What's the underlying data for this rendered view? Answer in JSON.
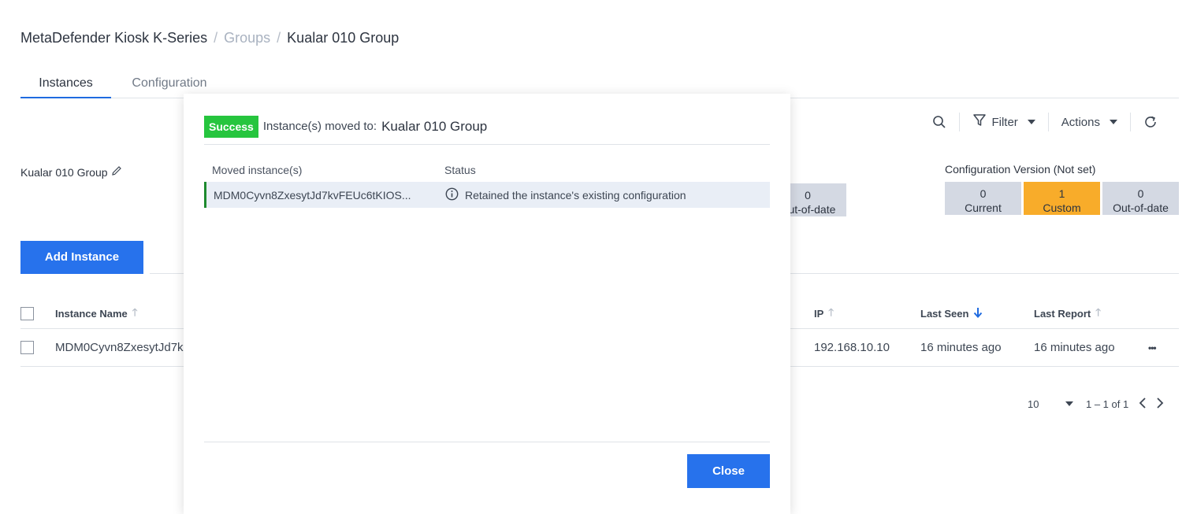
{
  "breadcrumb": {
    "root": "MetaDefender Kiosk K-Series",
    "separator": "/",
    "groups": "Groups",
    "current": "Kualar 010 Group"
  },
  "tabs": [
    {
      "label": "Instances",
      "active": true
    },
    {
      "label": "Configuration",
      "active": false
    }
  ],
  "toolbar": {
    "filter_label": "Filter",
    "actions_label": "Actions",
    "icons": [
      "search-icon",
      "filter-icon",
      "refresh-icon"
    ]
  },
  "group": {
    "name": "Kualar 010 Group",
    "edit_icon": "pencil-icon"
  },
  "agent_version_partial": {
    "count": "0",
    "label": "Out-of-date"
  },
  "config_version": {
    "title": "Configuration Version (Not set)",
    "stats": [
      {
        "count": "0",
        "label": "Current"
      },
      {
        "count": "1",
        "label": "Custom"
      },
      {
        "count": "0",
        "label": "Out-of-date"
      }
    ],
    "custom_color": "#f8ac2a"
  },
  "add_instance_label": "Add Instance",
  "table": {
    "headers": {
      "instance_name": "Instance Name",
      "ip": "IP",
      "last_seen": "Last Seen",
      "last_report": "Last Report"
    },
    "rows": [
      {
        "instance_name": "MDM0Cyvn8ZxesytJd7k",
        "ip": "192.168.10.10",
        "last_seen": "16 minutes ago",
        "last_report": "16 minutes ago",
        "more_label": "•••"
      }
    ]
  },
  "pager": {
    "page_size": "10",
    "range": "1 – 1 of 1"
  },
  "modal": {
    "badge": "Success",
    "moved_label": "Instance(s) moved to:",
    "moved_target": "Kualar 010 Group",
    "headers": {
      "moved": "Moved instance(s)",
      "status": "Status"
    },
    "rows": [
      {
        "instance": "MDM0Cyvn8ZxesytJd7kvFEUc6tKIOS...",
        "status": "Retained the instance's existing configuration"
      }
    ],
    "close_label": "Close",
    "badge_color": "#26c53e",
    "accent_color": "#2772ec"
  }
}
